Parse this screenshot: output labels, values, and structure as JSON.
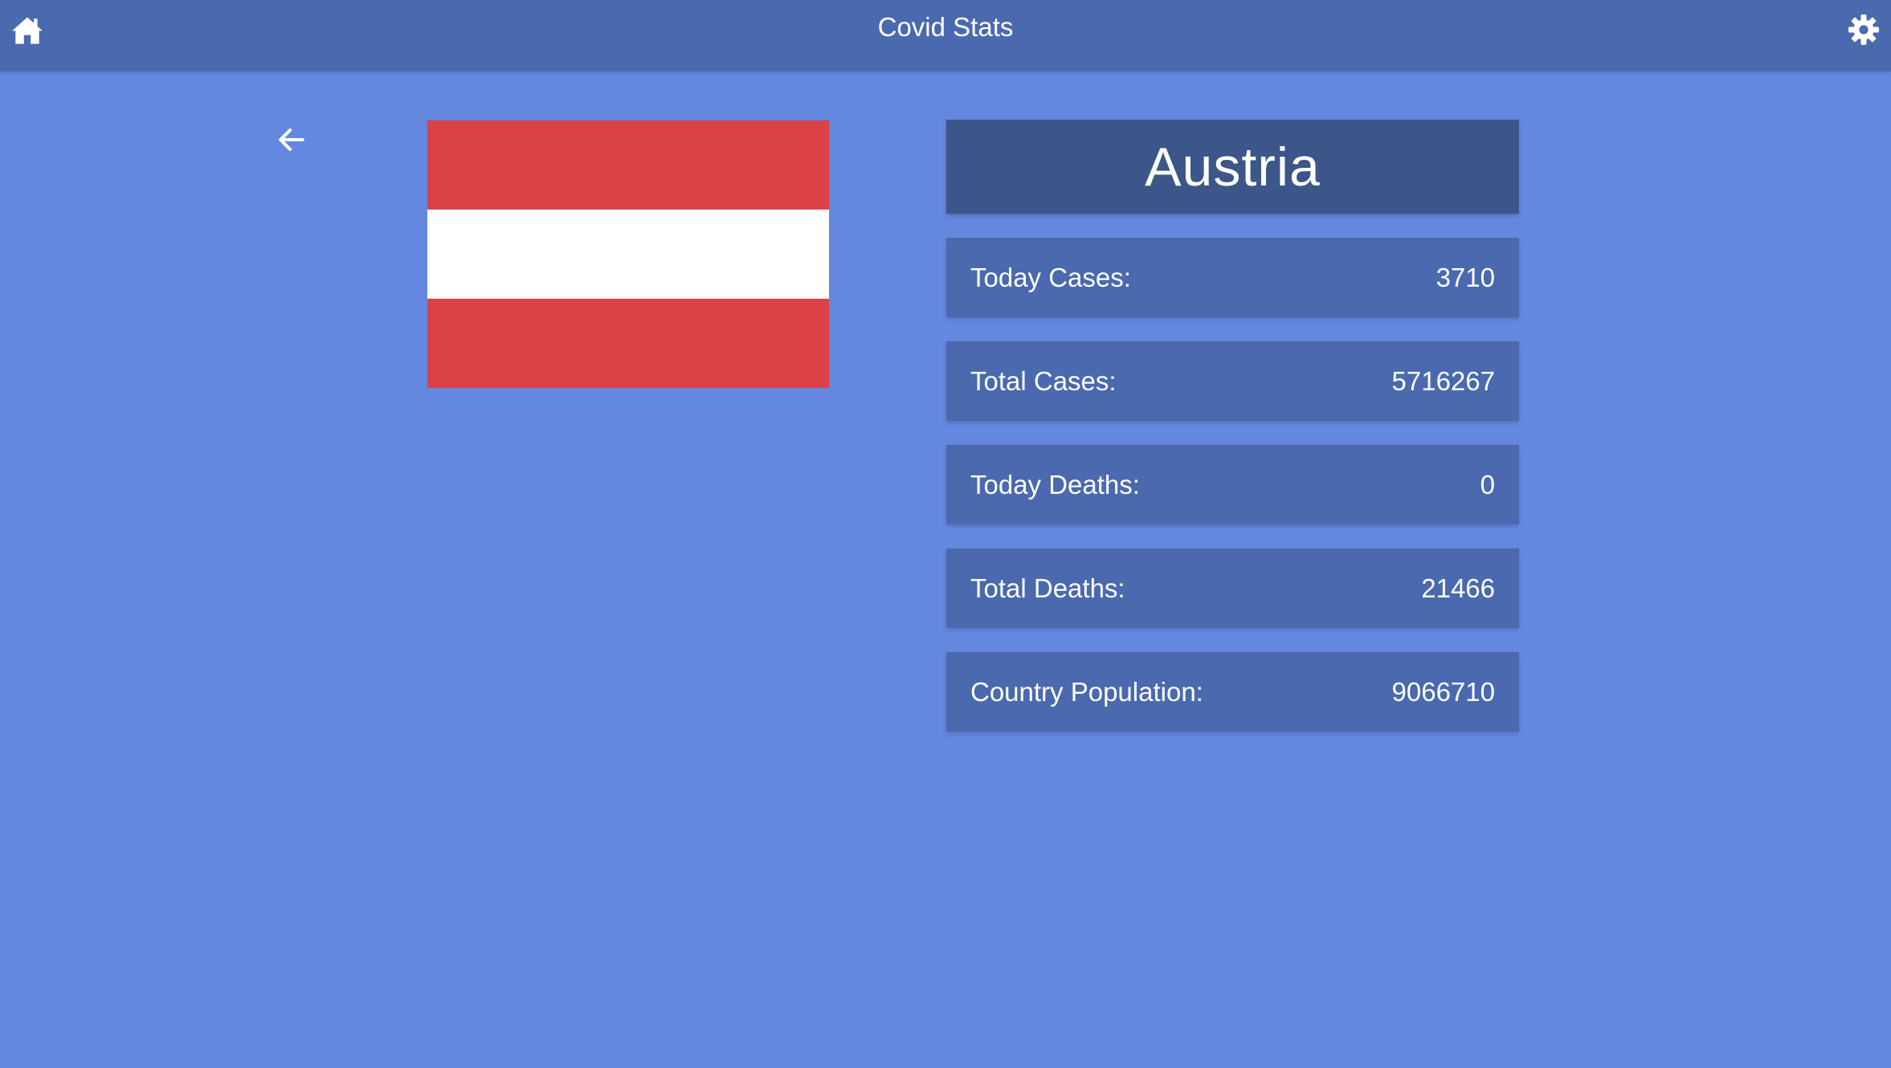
{
  "app": {
    "title": "Covid Stats"
  },
  "icons": {
    "home": "home-icon",
    "settings": "gear-icon",
    "back": "arrow-left-icon"
  },
  "colors": {
    "background": "#6488df",
    "topbar": "#4b69ae",
    "country_card": "#3c5689",
    "stat_row": "#4a69ae",
    "flag_red": "#dc4245",
    "flag_white": "#ffffff"
  },
  "country": {
    "name": "Austria",
    "flag_stripes": [
      "#dc4245",
      "#ffffff",
      "#dc4245"
    ]
  },
  "stats": [
    {
      "label": "Today Cases:",
      "value": "3710"
    },
    {
      "label": "Total Cases:",
      "value": "5716267"
    },
    {
      "label": "Today Deaths:",
      "value": "0"
    },
    {
      "label": "Total Deaths:",
      "value": "21466"
    },
    {
      "label": "Country Population:",
      "value": "9066710"
    }
  ]
}
